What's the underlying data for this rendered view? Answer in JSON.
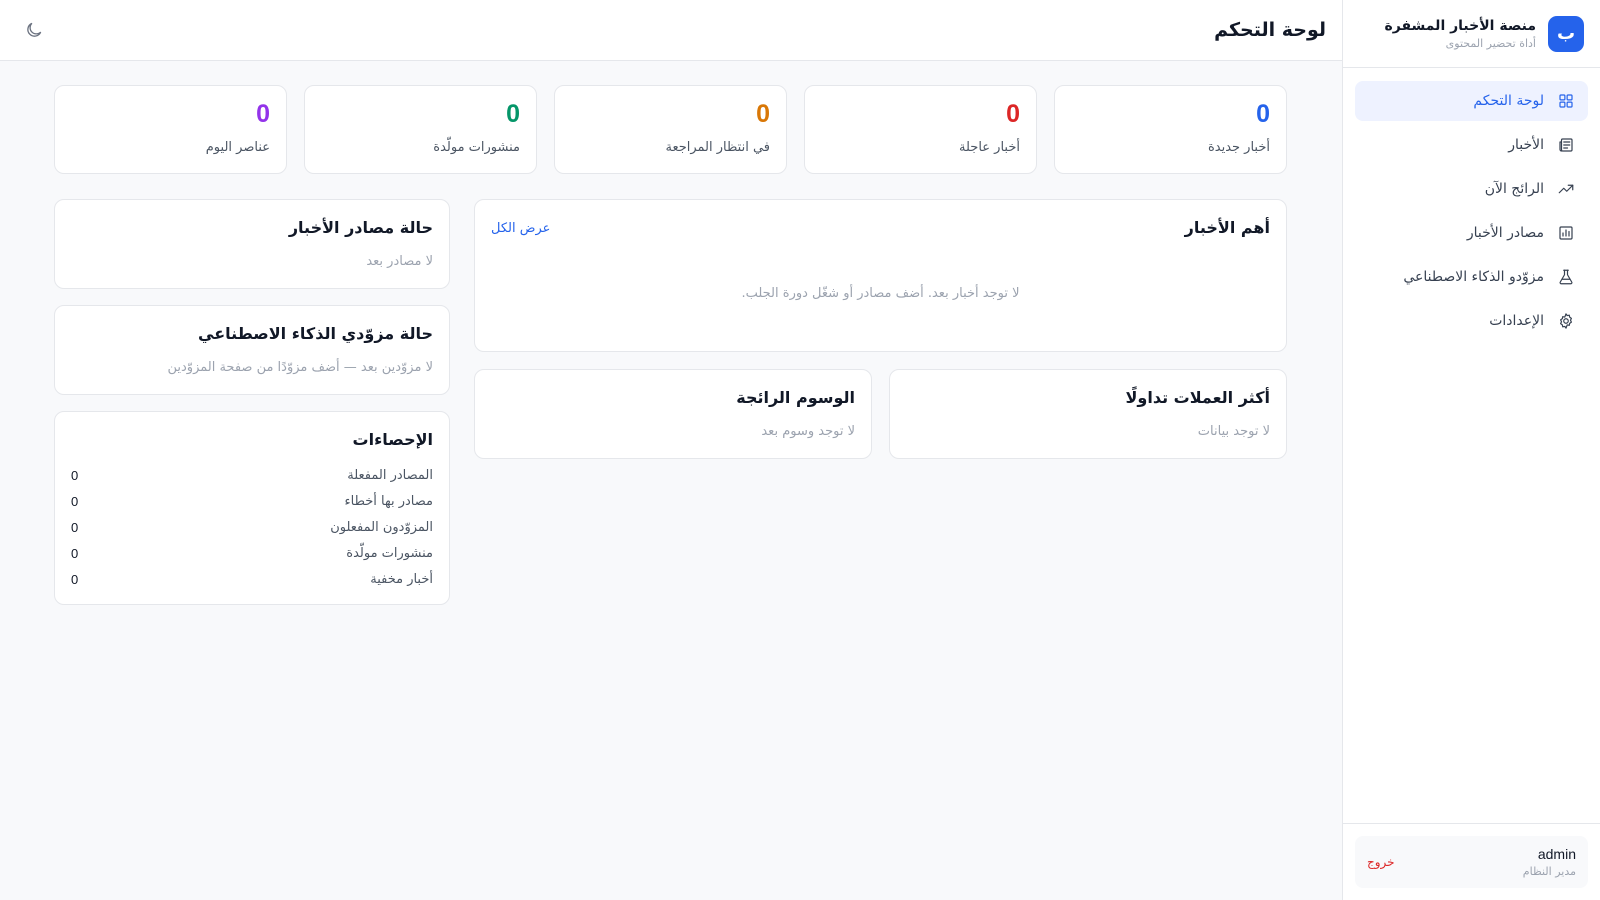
{
  "brand": {
    "logo_letter": "ب",
    "title": "منصة الأخبار المشفرة",
    "subtitle": "أداة تحضير المحتوى",
    "color": "#2563eb"
  },
  "sidebar": {
    "items": [
      {
        "label": "لوحة التحكم",
        "icon": "grid-icon",
        "active": true
      },
      {
        "label": "الأخبار",
        "icon": "newspaper-icon",
        "active": false
      },
      {
        "label": "الرائج الآن",
        "icon": "trending-icon",
        "active": false
      },
      {
        "label": "مصادر الأخبار",
        "icon": "bar-chart-icon",
        "active": false
      },
      {
        "label": "مزوّدو الذكاء الاصطناعي",
        "icon": "flask-icon",
        "active": false
      },
      {
        "label": "الإعدادات",
        "icon": "gear-icon",
        "active": false
      }
    ]
  },
  "user": {
    "name": "admin",
    "role": "مدير النظام",
    "logout_label": "خروج"
  },
  "header": {
    "title": "لوحة التحكم",
    "theme_icon": "moon-icon"
  },
  "stats": [
    {
      "value": "0",
      "label": "أخبار جديدة",
      "color": "#2563eb"
    },
    {
      "value": "0",
      "label": "أخبار عاجلة",
      "color": "#dc2626"
    },
    {
      "value": "0",
      "label": "في انتظار المراجعة",
      "color": "#d97706"
    },
    {
      "value": "0",
      "label": "منشورات مولّدة",
      "color": "#059669"
    },
    {
      "value": "0",
      "label": "عناصر اليوم",
      "color": "#9333ea"
    }
  ],
  "top_news": {
    "title": "أهم الأخبار",
    "view_all": "عرض الكل",
    "empty": "لا توجد أخبار بعد. أضف مصادر أو شغّل دورة الجلب."
  },
  "top_coins": {
    "title": "أكثر العملات تداولًا",
    "empty": "لا توجد بيانات"
  },
  "trending_tags": {
    "title": "الوسوم الرائجة",
    "empty": "لا توجد وسوم بعد"
  },
  "sources_status": {
    "title": "حالة مصادر الأخبار",
    "empty": "لا مصادر بعد"
  },
  "ai_status": {
    "title": "حالة مزوّدي الذكاء الاصطناعي",
    "empty": "لا مزوّدين بعد — أضف مزوّدًا من صفحة المزوّدين"
  },
  "statistics": {
    "title": "الإحصاءات",
    "rows": [
      {
        "label": "المصادر المفعلة",
        "value": "0"
      },
      {
        "label": "مصادر بها أخطاء",
        "value": "0"
      },
      {
        "label": "المزوّدون المفعلون",
        "value": "0"
      },
      {
        "label": "منشورات مولّدة",
        "value": "0"
      },
      {
        "label": "أخبار مخفية",
        "value": "0"
      }
    ]
  }
}
